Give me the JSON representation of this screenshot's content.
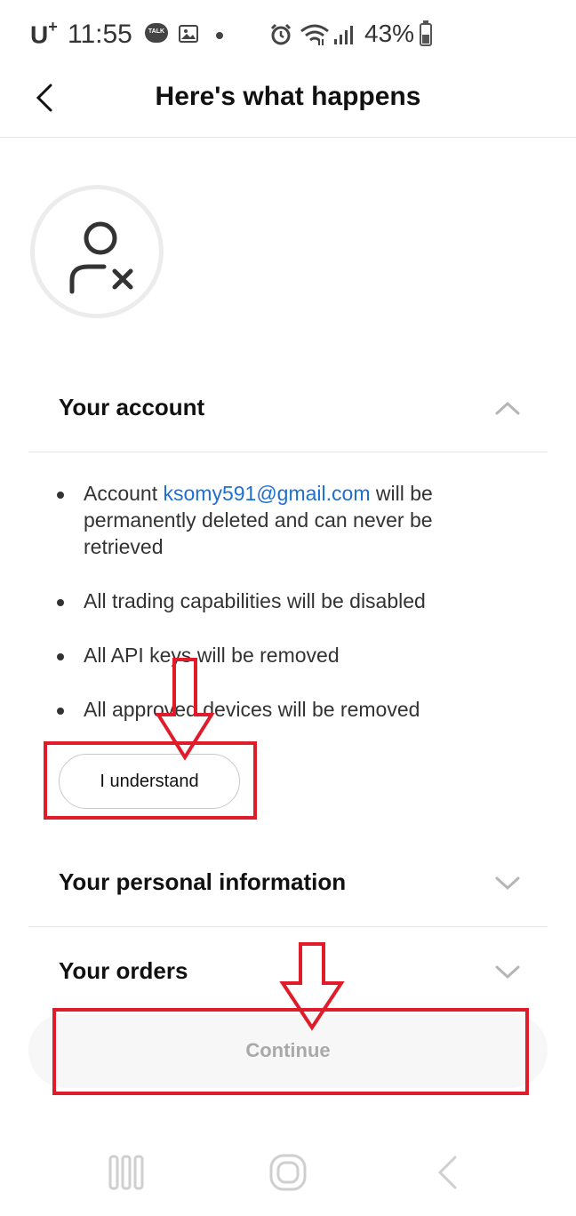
{
  "status_bar": {
    "carrier": "U",
    "carrier_sup": "+",
    "time": "11:55",
    "talk_icon_text": "TALK",
    "battery": "43%",
    "icons": [
      "talk-icon",
      "gallery-icon",
      "dot-icon",
      "alarm-icon",
      "wifi-icon",
      "signal-icon",
      "battery-icon"
    ]
  },
  "header": {
    "title": "Here's what happens",
    "back_icon": "chevron-left-icon"
  },
  "avatar_icon": "user-remove-icon",
  "sections": {
    "account": {
      "title": "Your account",
      "expanded": true,
      "bullets": {
        "b1_prefix": "Account ",
        "b1_email": "ksomy591@gmail.com",
        "b1_suffix": " will be permanently deleted and can never be retrieved",
        "b2": "All trading capabilities will be disabled",
        "b3": "All API keys will be removed",
        "b4": "All approved devices will be removed"
      },
      "button_label": "I understand"
    },
    "personal": {
      "title": "Your personal information",
      "expanded": false
    },
    "orders": {
      "title": "Your orders",
      "expanded": false
    }
  },
  "continue_label": "Continue",
  "colors": {
    "link": "#1f6fd0",
    "annotation": "#e01b2a",
    "disabled_text": "#a9a9a9"
  }
}
